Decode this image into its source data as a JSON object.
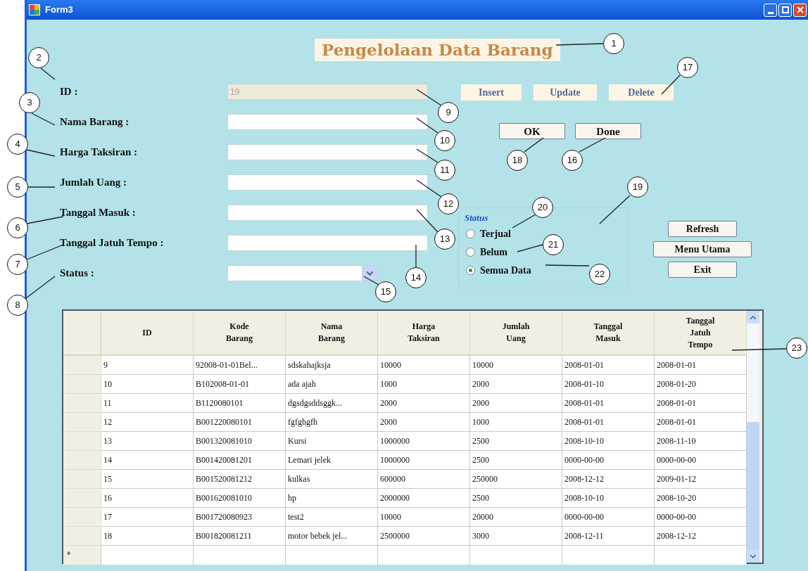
{
  "window": {
    "title": "Form3"
  },
  "heading": "Pengelolaan Data Barang",
  "fields": [
    {
      "label": "ID :",
      "kind": "locked",
      "value": "19"
    },
    {
      "label": "Nama Barang :",
      "kind": "text"
    },
    {
      "label": "Harga Taksiran :",
      "kind": "text"
    },
    {
      "label": "Jumlah Uang :",
      "kind": "text"
    },
    {
      "label": "Tanggal Masuk :",
      "kind": "text"
    },
    {
      "label": "Tanggal Jatuh Tempo :",
      "kind": "text"
    },
    {
      "label": "Status :",
      "kind": "combo"
    }
  ],
  "action_buttons": [
    "Insert",
    "Update",
    "Delete"
  ],
  "confirm_buttons": [
    "OK",
    "Done"
  ],
  "status_group": {
    "title": "Status",
    "options": [
      {
        "label": "Terjual",
        "selected": false
      },
      {
        "label": "Belum",
        "selected": false
      },
      {
        "label": "Semua Data",
        "selected": true
      }
    ]
  },
  "side_buttons": [
    "Refresh",
    "Menu Utama",
    "Exit"
  ],
  "table": {
    "columns": [
      "ID",
      "Kode Barang",
      "Nama Barang",
      "Harga Taksiran",
      "Jumlah Uang",
      "Tanggal Masuk",
      "Tanggal Jatuh Tempo"
    ],
    "rows": [
      [
        "9",
        "92008-01-01Bel...",
        "sdskahajksja",
        "10000",
        "10000",
        "2008-01-01",
        "2008-01-01"
      ],
      [
        "10",
        "B102008-01-01",
        "ada ajah",
        "1000",
        "2000",
        "2008-01-10",
        "2008-01-20"
      ],
      [
        "11",
        "B1120080101",
        "dgsdgsddsggk...",
        "2000",
        "2000",
        "2008-01-01",
        "2008-01-01"
      ],
      [
        "12",
        "B001220080101",
        "fgfghgfh",
        "2000",
        "1000",
        "2008-01-01",
        "2008-01-01"
      ],
      [
        "13",
        "B001320081010",
        "Kursi",
        "1000000",
        "2500",
        "2008-10-10",
        "2008-11-10"
      ],
      [
        "14",
        "B001420081201",
        "Lemari jelek",
        "1000000",
        "2500",
        "0000-00-00",
        "0000-00-00"
      ],
      [
        "15",
        "B001520081212",
        "kulkas",
        "600000",
        "250000",
        "2008-12-12",
        "2009-01-12"
      ],
      [
        "16",
        "B001620081010",
        "hp",
        "2000000",
        "2500",
        "2008-10-10",
        "2008-10-20"
      ],
      [
        "17",
        "B001720080923",
        "test2",
        "10000",
        "20000",
        "0000-00-00",
        "0000-00-00"
      ],
      [
        "18",
        "B001820081211",
        "motor bebek jel...",
        "2500000",
        "3000",
        "2008-12-11",
        "2008-12-12"
      ]
    ],
    "new_row_marker": "*"
  },
  "callouts": [
    {
      "number": "1"
    },
    {
      "number": "2"
    },
    {
      "number": "3"
    },
    {
      "number": "4"
    },
    {
      "number": "5"
    },
    {
      "number": "6"
    },
    {
      "number": "7"
    },
    {
      "number": "8"
    },
    {
      "number": "9"
    },
    {
      "number": "10"
    },
    {
      "number": "11"
    },
    {
      "number": "12"
    },
    {
      "number": "13"
    },
    {
      "number": "14"
    },
    {
      "number": "15"
    },
    {
      "number": "16"
    },
    {
      "number": "17"
    },
    {
      "number": "18"
    },
    {
      "number": "19"
    },
    {
      "number": "20"
    },
    {
      "number": "21"
    },
    {
      "number": "22"
    },
    {
      "number": "23"
    }
  ]
}
